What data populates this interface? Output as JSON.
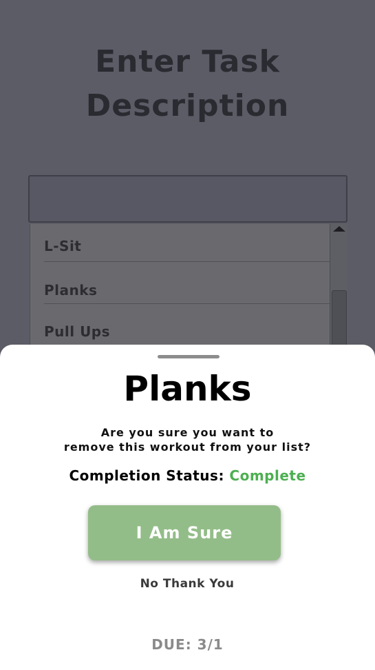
{
  "background": {
    "title_line1": "Enter Task",
    "title_line2": "Description",
    "input_value": "",
    "list_items": [
      "L-Sit",
      "Planks",
      "Pull Ups"
    ]
  },
  "sheet": {
    "title": "Planks",
    "message_line1": "Are you sure you want to",
    "message_line2": "remove this workout from your list?",
    "status_label": "Completion Status:",
    "status_value": "Complete",
    "confirm_label": "I Am Sure",
    "cancel_label": "No Thank You",
    "due_label": "DUE: 3/1"
  },
  "colors": {
    "status_complete": "#4caf50",
    "confirm_button": "#93bd88"
  }
}
